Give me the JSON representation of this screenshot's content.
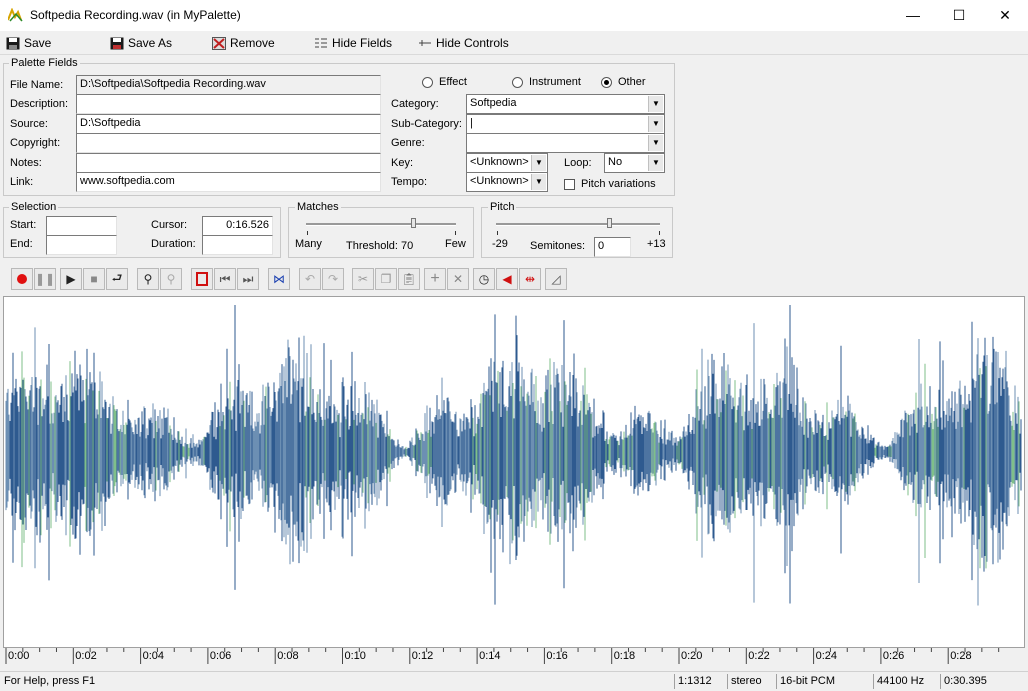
{
  "window": {
    "title": "Softpedia Recording.wav (in MyPalette)",
    "minimize": "—",
    "maximize": "☐",
    "close": "✕"
  },
  "toolbar": {
    "save": "Save",
    "save_as": "Save As",
    "remove": "Remove",
    "hide_fields": "Hide Fields",
    "hide_controls": "Hide Controls"
  },
  "palette_fields": {
    "group_label": "Palette Fields",
    "file_name_label": "File Name:",
    "file_name": "D:\\Softpedia\\Softpedia Recording.wav",
    "description_label": "Description:",
    "description": "",
    "source_label": "Source:",
    "source": "D:\\Softpedia",
    "copyright_label": "Copyright:",
    "copyright": "",
    "notes_label": "Notes:",
    "notes": "",
    "link_label": "Link:",
    "link": "www.softpedia.com",
    "type_options": [
      "Effect",
      "Instrument",
      "Other"
    ],
    "type_selected": "Other",
    "category_label": "Category:",
    "category": "Softpedia",
    "subcategory_label": "Sub-Category:",
    "subcategory": "|",
    "genre_label": "Genre:",
    "genre": "",
    "key_label": "Key:",
    "key": "<Unknown>",
    "loop_label": "Loop:",
    "loop": "No",
    "tempo_label": "Tempo:",
    "tempo": "<Unknown>",
    "pitch_variations_label": "Pitch variations",
    "pitch_variations_checked": false
  },
  "selection": {
    "group_label": "Selection",
    "start_label": "Start:",
    "start": "",
    "end_label": "End:",
    "end": "",
    "cursor_label": "Cursor:",
    "cursor": "0:16.526",
    "duration_label": "Duration:",
    "duration": ""
  },
  "matches": {
    "group_label": "Matches",
    "many_label": "Many",
    "threshold_label": "Threshold: 70",
    "few_label": "Few",
    "threshold_value": 70
  },
  "pitch": {
    "group_label": "Pitch",
    "min_label": "-29",
    "semitones_label": "Semitones:",
    "semitones": "0",
    "max_label": "+13"
  },
  "transport_icons": [
    "record-icon",
    "pause-icon",
    "play-icon",
    "stop-icon",
    "loop-play-icon",
    "zoom-in-icon",
    "zoom-out-icon",
    "select-all-icon",
    "go-start-icon",
    "go-end-icon",
    "normalize-icon",
    "undo-icon",
    "redo-icon",
    "cut-icon",
    "copy-icon",
    "paste-icon",
    "add-icon",
    "delete-icon",
    "timer-icon",
    "speaker-icon",
    "split-icon",
    "fade-icon"
  ],
  "timeline": {
    "labels": [
      "0:00",
      "0:02",
      "0:04",
      "0:06",
      "0:08",
      "0:10",
      "0:12",
      "0:14",
      "0:16",
      "0:18",
      "0:20",
      "0:22",
      "0:24",
      "0:26",
      "0:28"
    ]
  },
  "status": {
    "help": "For Help, press F1",
    "zoom": "1:1312",
    "channels": "stereo",
    "format": "16-bit PCM",
    "rate": "44100 Hz",
    "length": "0:30.395"
  },
  "colors": {
    "wave_blue": "#2e5a8f",
    "wave_mid": "#6c8fb3",
    "wave_green": "#7fbf8a"
  }
}
